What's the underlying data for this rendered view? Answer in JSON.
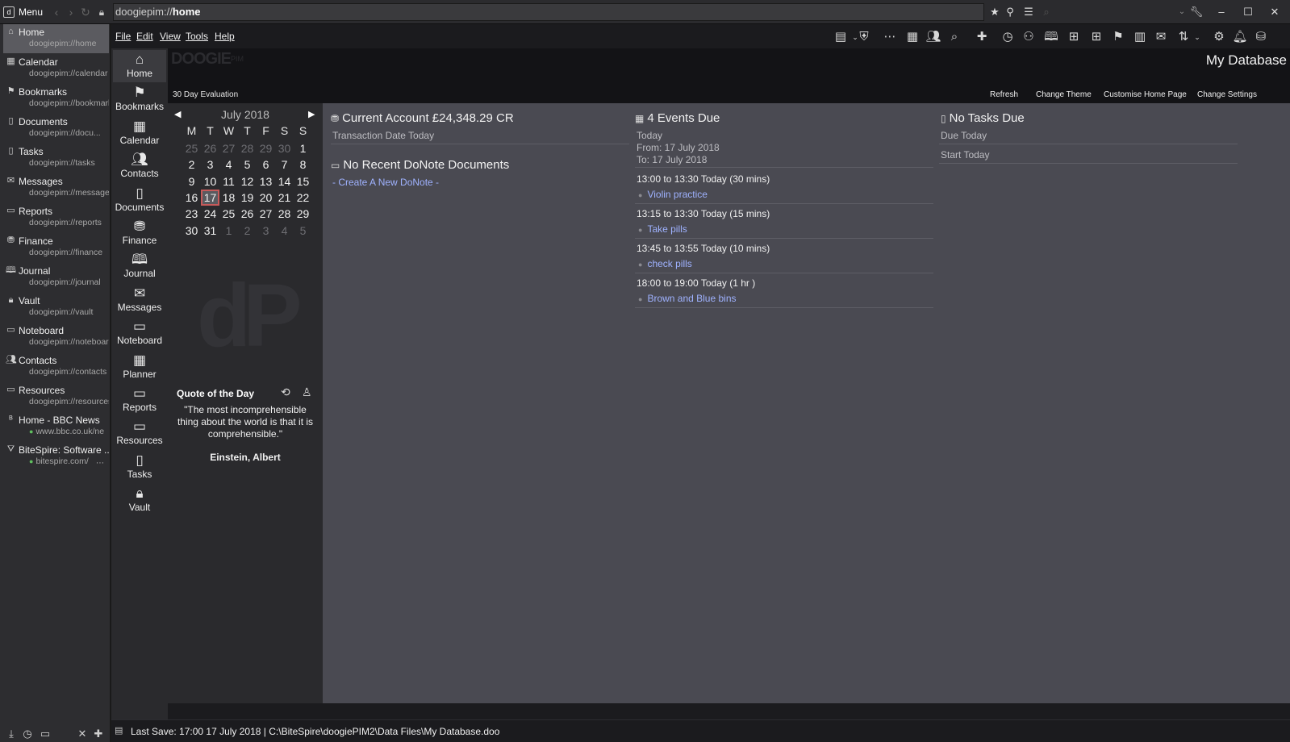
{
  "browser": {
    "menu_label": "Menu",
    "address_prefix": "doogiepim://",
    "address_path": "home"
  },
  "sidebar": {
    "items": [
      {
        "title": "Home",
        "url": "doogiepim://home",
        "icon": "home-icon"
      },
      {
        "title": "Calendar",
        "url": "doogiepim://calendar",
        "icon": "calendar-icon"
      },
      {
        "title": "Bookmarks",
        "url": "doogiepim://bookmarks",
        "icon": "bookmark-icon"
      },
      {
        "title": "Documents",
        "url": "doogiepim://docu...",
        "icon": "document-icon"
      },
      {
        "title": "Tasks",
        "url": "doogiepim://tasks",
        "icon": "clipboard-icon"
      },
      {
        "title": "Messages",
        "url": "doogiepim://messages",
        "icon": "envelope-icon"
      },
      {
        "title": "Reports",
        "url": "doogiepim://reports",
        "icon": "folder-icon"
      },
      {
        "title": "Finance",
        "url": "doogiepim://finance",
        "icon": "coins-icon"
      },
      {
        "title": "Journal",
        "url": "doogiepim://journal",
        "icon": "book-icon"
      },
      {
        "title": "Vault",
        "url": "doogiepim://vault",
        "icon": "lock-icon"
      },
      {
        "title": "Noteboard",
        "url": "doogiepim://noteboard",
        "icon": "noteboard-icon"
      },
      {
        "title": "Contacts",
        "url": "doogiepim://contacts",
        "icon": "people-icon"
      },
      {
        "title": "Resources",
        "url": "doogiepim://resources",
        "icon": "box-icon"
      },
      {
        "title": "Home - BBC News",
        "url": "www.bbc.co.uk/ne",
        "icon": "bbc-icon"
      },
      {
        "title": "BiteSpire: Software ...",
        "url": "bitespire.com/",
        "icon": "bitespire-icon"
      }
    ]
  },
  "menubar": {
    "file": "File",
    "edit": "Edit",
    "view": "View",
    "tools": "Tools",
    "help": "Help"
  },
  "nav": {
    "items": [
      "Home",
      "Bookmarks",
      "Calendar",
      "Contacts",
      "Documents",
      "Finance",
      "Journal",
      "Messages",
      "Noteboard",
      "Planner",
      "Reports",
      "Resources",
      "Tasks",
      "Vault"
    ]
  },
  "header": {
    "logo": "DOOGIE",
    "logo_sub": "PIM",
    "evaluation": "30 Day Evaluation",
    "database_name": "My Database",
    "links": {
      "refresh": "Refresh",
      "change_theme": "Change Theme",
      "customise": "Customise Home Page",
      "settings": "Change Settings"
    }
  },
  "calendar": {
    "title": "July 2018",
    "dow": [
      "M",
      "T",
      "W",
      "T",
      "F",
      "S",
      "S"
    ],
    "weeks": [
      [
        "25",
        "26",
        "27",
        "28",
        "29",
        "30",
        "1"
      ],
      [
        "2",
        "3",
        "4",
        "5",
        "6",
        "7",
        "8"
      ],
      [
        "9",
        "10",
        "11",
        "12",
        "13",
        "14",
        "15"
      ],
      [
        "16",
        "17",
        "18",
        "19",
        "20",
        "21",
        "22"
      ],
      [
        "23",
        "24",
        "25",
        "26",
        "27",
        "28",
        "29"
      ],
      [
        "30",
        "31",
        "1",
        "2",
        "3",
        "4",
        "5"
      ]
    ],
    "dim": [
      [
        0,
        0
      ],
      [
        0,
        1
      ],
      [
        0,
        2
      ],
      [
        0,
        3
      ],
      [
        0,
        4
      ],
      [
        0,
        5
      ],
      [
        5,
        2
      ],
      [
        5,
        3
      ],
      [
        5,
        4
      ],
      [
        5,
        5
      ],
      [
        5,
        6
      ]
    ],
    "today": [
      3,
      1
    ]
  },
  "quote": {
    "title": "Quote of the Day",
    "text": "\"The most incomprehensible thing about the world is that it is comprehensible.\"",
    "author": "Einstein, Albert"
  },
  "account": {
    "title": "Current Account £24,348.29 CR",
    "subtitle": "Transaction Date Today"
  },
  "donote": {
    "title": "No Recent DoNote Documents",
    "link": "- Create A New DoNote -"
  },
  "events": {
    "title": "4 Events Due",
    "when": "Today",
    "from": "From: 17 July 2018",
    "to": "To: 17 July 2018",
    "items": [
      {
        "time": "13:00 to 13:30 Today (30 mins)",
        "name": "Violin practice"
      },
      {
        "time": "13:15 to 13:30 Today (15 mins)",
        "name": "Take pills"
      },
      {
        "time": "13:45 to 13:55 Today (10 mins)",
        "name": "check pills"
      },
      {
        "time": "18:00 to 19:00 Today (1 hr )",
        "name": "Brown and Blue bins"
      }
    ]
  },
  "tasks": {
    "title": "No Tasks Due",
    "due": "Due Today",
    "start": "Start Today"
  },
  "status": {
    "text": "Last Save: 17:00 17 July 2018 | C:\\BiteSpire\\doogiePIM2\\Data Files\\My Database.doo"
  }
}
